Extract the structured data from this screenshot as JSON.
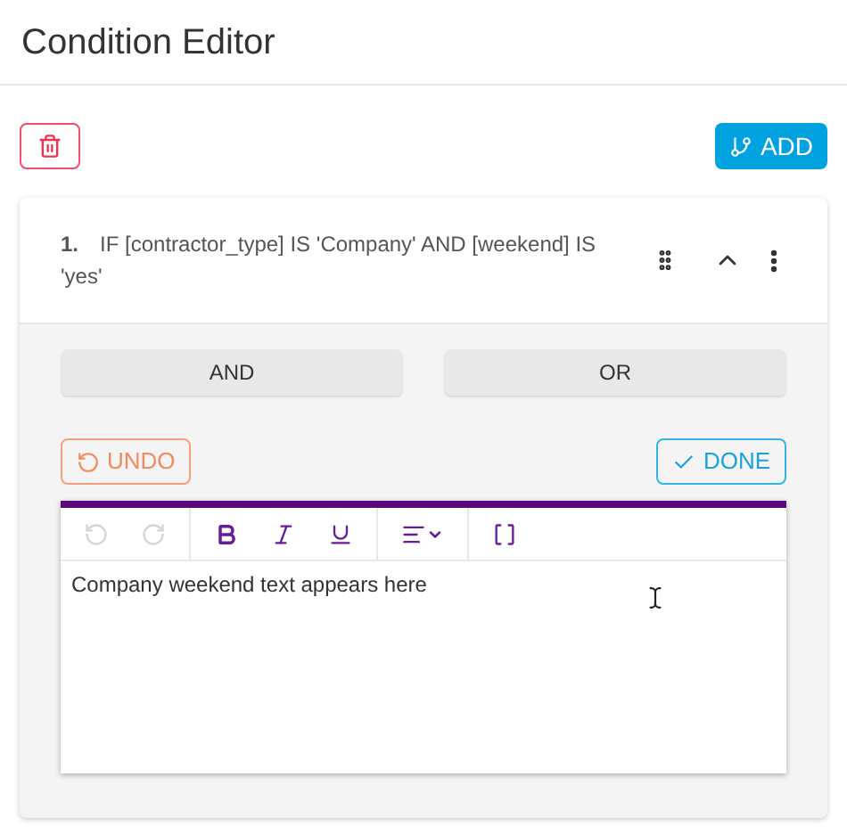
{
  "title": "Condition Editor",
  "add_button": "ADD",
  "condition": {
    "number": "1.",
    "text": "IF [contractor_type] IS 'Company' AND [weekend] IS 'yes'",
    "expanded": true
  },
  "operators": [
    "AND",
    "OR"
  ],
  "undo_button": "UNDO",
  "done_button": "DONE",
  "toolbar": [
    {
      "kind": "undo",
      "disabled": true
    },
    {
      "kind": "redo",
      "disabled": true
    },
    {
      "kind": "bold",
      "disabled": false
    },
    {
      "kind": "italic",
      "disabled": false
    },
    {
      "kind": "underline",
      "disabled": false
    },
    {
      "kind": "align",
      "disabled": false
    },
    {
      "kind": "brackets",
      "disabled": false
    }
  ],
  "editor_text": "Company weekend text appears here"
}
